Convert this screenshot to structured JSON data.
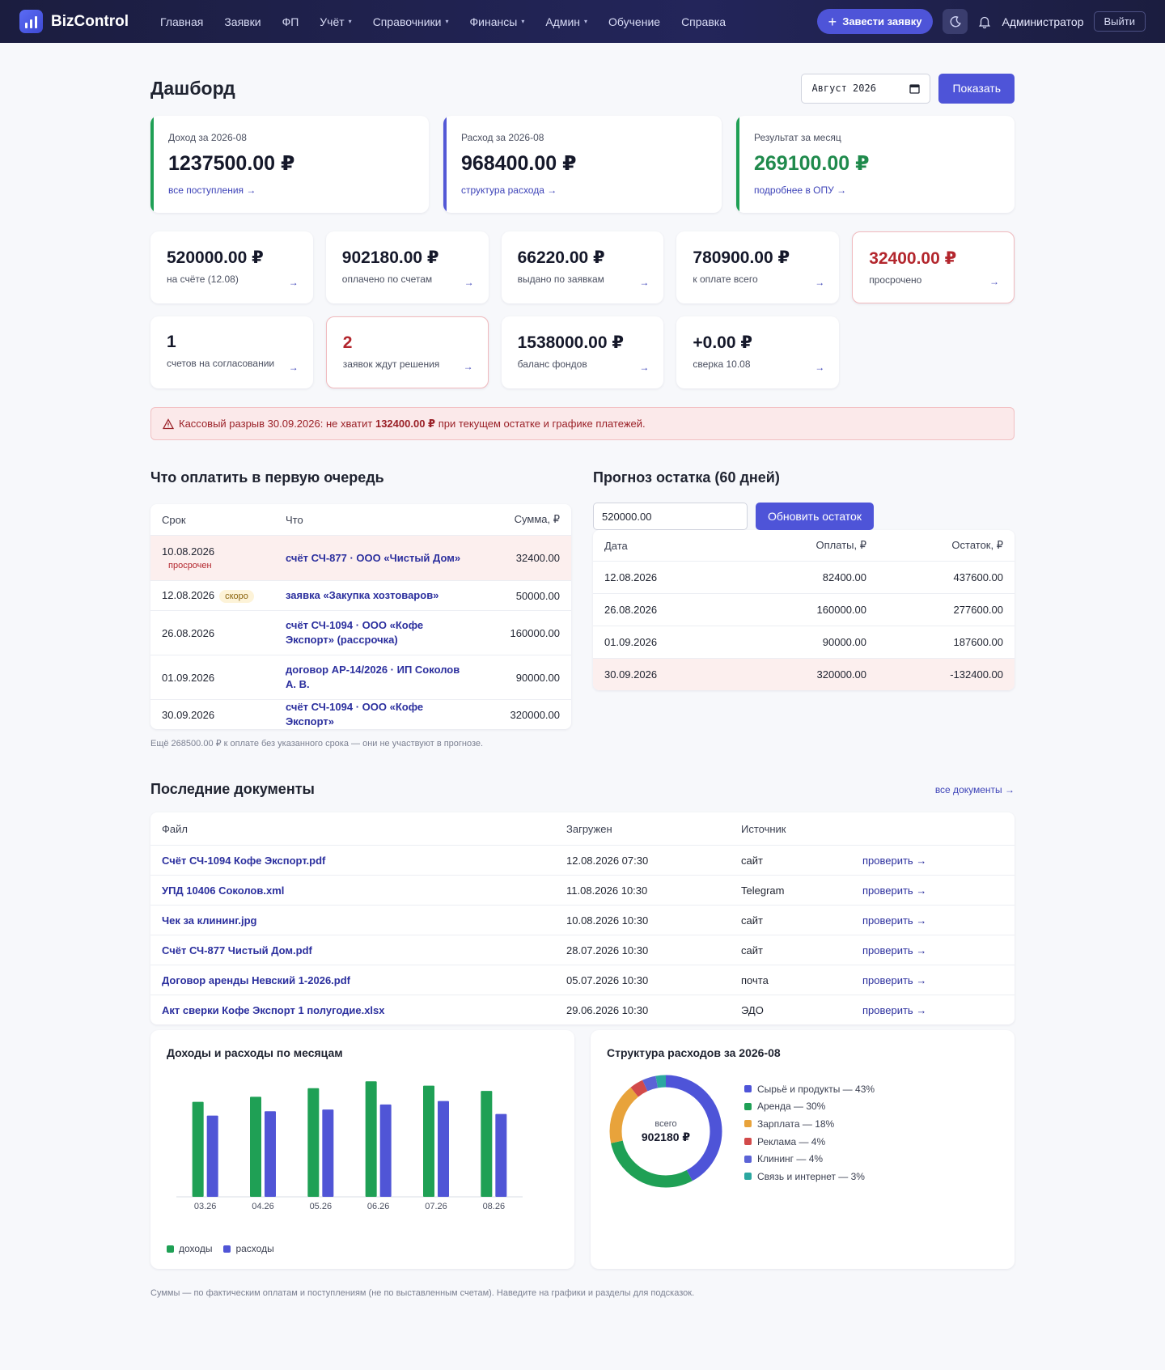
{
  "nav": {
    "brand": "BizControl",
    "items": [
      {
        "label": "Главная",
        "dropdown": false
      },
      {
        "label": "Заявки",
        "dropdown": false
      },
      {
        "label": "ФП",
        "dropdown": false
      },
      {
        "label": "Учёт",
        "dropdown": true
      },
      {
        "label": "Справочники",
        "dropdown": true
      },
      {
        "label": "Финансы",
        "dropdown": true
      },
      {
        "label": "Админ",
        "dropdown": true
      },
      {
        "label": "Обучение",
        "dropdown": false
      },
      {
        "label": "Справка",
        "dropdown": false
      }
    ],
    "new_request": "Завести заявку",
    "user": "Администратор",
    "logout": "Выйти"
  },
  "header": {
    "title": "Дашборд",
    "month_value": "Август 2026",
    "show_button": "Показать"
  },
  "kpis": [
    {
      "label": "Доход за 2026-08",
      "value": "1237500.00 ₽",
      "link": "все поступления →",
      "accent": "green"
    },
    {
      "label": "Расход за 2026-08",
      "value": "968400.00 ₽",
      "link": "структура расхода →",
      "accent": "indigo"
    },
    {
      "label": "Результат за месяц",
      "value": "269100.00 ₽",
      "link": "подробнее в ОПУ →",
      "accent": "green"
    }
  ],
  "stats": [
    {
      "value": "520000.00 ₽",
      "label": "на счёте (12.08)"
    },
    {
      "value": "902180.00 ₽",
      "label": "оплачено по счетам"
    },
    {
      "value": "66220.00 ₽",
      "label": "выдано по заявкам"
    },
    {
      "value": "780900.00 ₽",
      "label": "к оплате всего"
    },
    {
      "value": "32400.00 ₽",
      "label": "просрочено"
    }
  ],
  "stats2": [
    {
      "value": "1",
      "label": "счетов на согласовании"
    },
    {
      "value": "2",
      "label": "заявок ждут решения"
    },
    {
      "value": "1538000.00 ₽",
      "label": "баланс фондов"
    },
    {
      "value": "+0.00 ₽",
      "label": "сверка 10.08"
    }
  ],
  "arrow": "→",
  "cash_gap": {
    "before": "Кассовый разрыв 30.09.2026: не хватит ",
    "amount": "132400.00 ₽",
    "after": " при текущем остатке и графике платежей."
  },
  "payments": {
    "title": "Что оплатить в первую очередь",
    "columns": [
      "Срок",
      "Что",
      "Сумма, ₽"
    ],
    "rows": [
      {
        "date": "10.08.2026",
        "badge": "просрочен",
        "badge_type": "overdue",
        "what": "счёт СЧ-877 · ООО «Чистый Дом»",
        "sum": "32400.00"
      },
      {
        "date": "12.08.2026",
        "badge": "скоро",
        "badge_type": "soon",
        "what": "заявка «Закупка хозтоваров»",
        "sum": "50000.00"
      },
      {
        "date": "26.08.2026",
        "badge": "",
        "badge_type": "",
        "what": "счёт СЧ-1094 · ООО «Кофе Экспорт» (рассрочка)",
        "sum": "160000.00"
      },
      {
        "date": "01.09.2026",
        "badge": "",
        "badge_type": "",
        "what": "договор АР-14/2026 · ИП Соколов А. В.",
        "sum": "90000.00"
      },
      {
        "date": "30.09.2026",
        "badge": "",
        "badge_type": "",
        "what": "счёт СЧ-1094 · ООО «Кофе Экспорт»",
        "sum": "320000.00"
      }
    ],
    "note": "Ещё 268500.00 ₽ к оплате без указанного срока — они не участвуют в прогнозе."
  },
  "forecast": {
    "title": "Прогноз остатка (60 дней)",
    "input_value": "520000.00",
    "update_button": "Обновить остаток",
    "columns": [
      "Дата",
      "Оплаты, ₽",
      "Остаток, ₽"
    ],
    "rows": [
      {
        "date": "12.08.2026",
        "pay": "82400.00",
        "bal": "437600.00"
      },
      {
        "date": "26.08.2026",
        "pay": "160000.00",
        "bal": "277600.00"
      },
      {
        "date": "01.09.2026",
        "pay": "90000.00",
        "bal": "187600.00"
      },
      {
        "date": "30.09.2026",
        "pay": "320000.00",
        "bal": "-132400.00"
      }
    ]
  },
  "docs": {
    "title": "Последние документы",
    "all_link": "все документы →",
    "columns": [
      "Файл",
      "Загружен",
      "Источник"
    ],
    "action": "проверить →",
    "rows": [
      {
        "file": "Счёт СЧ-1094 Кофе Экспорт.pdf",
        "uploaded": "12.08.2026 07:30",
        "source": "сайт"
      },
      {
        "file": "УПД 10406 Соколов.xml",
        "uploaded": "11.08.2026 10:30",
        "source": "Telegram"
      },
      {
        "file": "Чек за клининг.jpg",
        "uploaded": "10.08.2026 10:30",
        "source": "сайт"
      },
      {
        "file": "Счёт СЧ-877 Чистый Дом.pdf",
        "uploaded": "28.07.2026 10:30",
        "source": "сайт"
      },
      {
        "file": "Договор аренды Невский 1-2026.pdf",
        "uploaded": "05.07.2026 10:30",
        "source": "почта"
      },
      {
        "file": "Акт сверки Кофе Экспорт 1 полугодие.xlsx",
        "uploaded": "29.06.2026 10:30",
        "source": "ЭДО"
      }
    ]
  },
  "chart_data": [
    {
      "type": "bar",
      "title": "Доходы и расходы по месяцам",
      "categories": [
        "03.26",
        "04.26",
        "05.26",
        "06.26",
        "07.26",
        "08.26"
      ],
      "series": [
        {
          "name": "доходы",
          "color": "#1fa055",
          "values": [
            1110000,
            1170000,
            1270000,
            1350000,
            1300000,
            1237500
          ]
        },
        {
          "name": "расходы",
          "color": "#5055d6",
          "values": [
            950000,
            1000000,
            1020000,
            1080000,
            1120000,
            968400
          ]
        }
      ],
      "ylim": [
        0,
        1400000
      ],
      "grid": false
    },
    {
      "type": "pie",
      "title": "Структура расходов за 2026-08",
      "center_caption": "всего",
      "center_value": "902180 ₽",
      "slices": [
        {
          "label": "Сырьё и продукты — 43%",
          "value": 43,
          "color": "#4e54d8"
        },
        {
          "label": "Аренда — 30%",
          "value": 30,
          "color": "#1fa055"
        },
        {
          "label": "Зарплата — 18%",
          "value": 18,
          "color": "#e8a33b"
        },
        {
          "label": "Реклама — 4%",
          "value": 4,
          "color": "#d24a4a"
        },
        {
          "label": "Клининг — 4%",
          "value": 4,
          "color": "#5b63d6"
        },
        {
          "label": "Связь и интернет — 3%",
          "value": 3,
          "color": "#2ba7a0"
        }
      ]
    }
  ],
  "footer_note": "Суммы — по фактическим оплатам и поступлениям (не по выставленным счетам). Наведите на графики и разделы для подсказок."
}
